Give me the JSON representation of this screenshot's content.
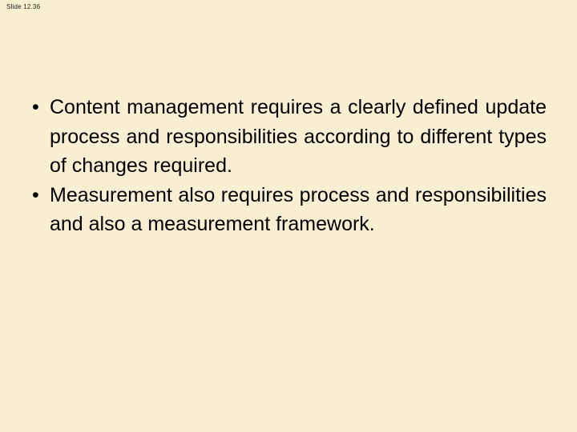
{
  "slide": {
    "header_label": "Slide 12.36",
    "background_color": "#f8efd2",
    "text_color": "#000000",
    "bullets": [
      {
        "marker": "•",
        "text": "Content management requires a clearly defined update process and responsibilities according to different types of changes required."
      },
      {
        "marker": "•",
        "text": "Measurement also requires process and responsibilities and also a measurement framework."
      }
    ]
  }
}
